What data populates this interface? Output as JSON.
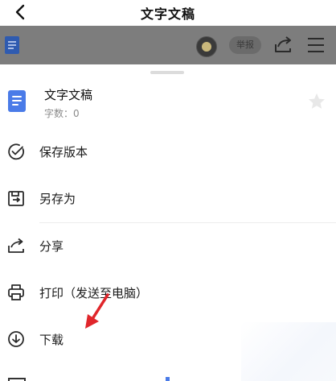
{
  "navbar": {
    "title": "文字文稿",
    "back_icon": "chevron-left-icon"
  },
  "toolbar": {
    "report_label": "举报",
    "share_icon": "share-icon",
    "menu_icon": "hamburger-menu-icon"
  },
  "sheet": {
    "file_title": "文字文稿",
    "file_meta": "字数：0",
    "favorite_icon": "star-icon",
    "items": [
      {
        "label": "保存版本",
        "icon": "check-circle-icon"
      },
      {
        "label": "另存为",
        "icon": "save-as-icon"
      },
      {
        "label": "分享",
        "icon": "share-icon"
      },
      {
        "label": "打印（发送至电脑）",
        "icon": "printer-icon"
      },
      {
        "label": "下载",
        "icon": "download-icon"
      }
    ]
  },
  "colors": {
    "accent": "#4a7be8",
    "arrow": "#e0262b",
    "dim_overlay": "#7d7d7d"
  }
}
